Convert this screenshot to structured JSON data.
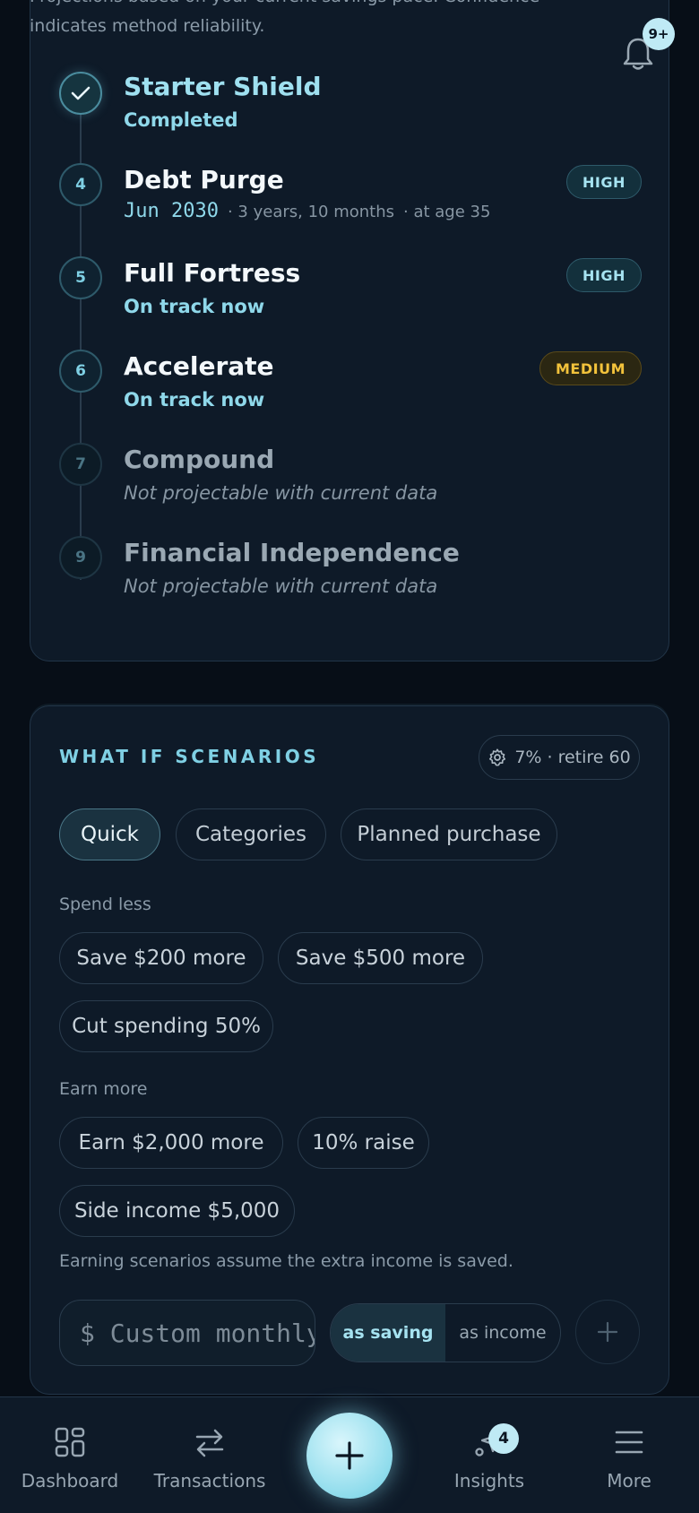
{
  "milestones": {
    "intro": "Projections based on your current savings pace. Confidence indicates method reliability.",
    "notification_badge": "9+",
    "items": [
      {
        "step": "",
        "icon": "check-icon",
        "title": "Starter Shield",
        "subtitle": "Completed"
      },
      {
        "step": "4",
        "title": "Debt Purge",
        "date": "Jun 2030",
        "duration": "· 3 years, 10 months",
        "age": "· at age 35",
        "confidence": "HIGH"
      },
      {
        "step": "5",
        "title": "Full Fortress",
        "subtitle": "On track now",
        "confidence": "HIGH"
      },
      {
        "step": "6",
        "title": "Accelerate",
        "subtitle": "On track now",
        "confidence": "MEDIUM"
      },
      {
        "step": "7",
        "title": "Compound",
        "subtitle": "Not projectable with current data"
      },
      {
        "step": "9",
        "title": "Financial Independence",
        "subtitle": "Not projectable with current data"
      }
    ]
  },
  "scenarios": {
    "title": "WHAT IF SCENARIOS",
    "settings": "7% · retire 60",
    "tabs": [
      "Quick",
      "Categories",
      "Planned purchase"
    ],
    "spend_label": "Spend less",
    "spend_chips": [
      "Save $200 more",
      "Save $500 more",
      "Cut spending 50%"
    ],
    "earn_label": "Earn more",
    "earn_chips": [
      "Earn $2,000 more",
      "10% raise",
      "Side income $5,000"
    ],
    "note": "Earning scenarios assume the extra income is saved.",
    "custom_placeholder": "$ Custom monthly",
    "mode_options": [
      "as saving",
      "as income"
    ]
  },
  "nav": {
    "items": [
      "Dashboard",
      "Transactions",
      "Insights",
      "More"
    ],
    "insights_badge": "4"
  },
  "colors": {
    "accent": "#7fd0e4",
    "medium": "#f2c23b",
    "background": "#070e17"
  }
}
